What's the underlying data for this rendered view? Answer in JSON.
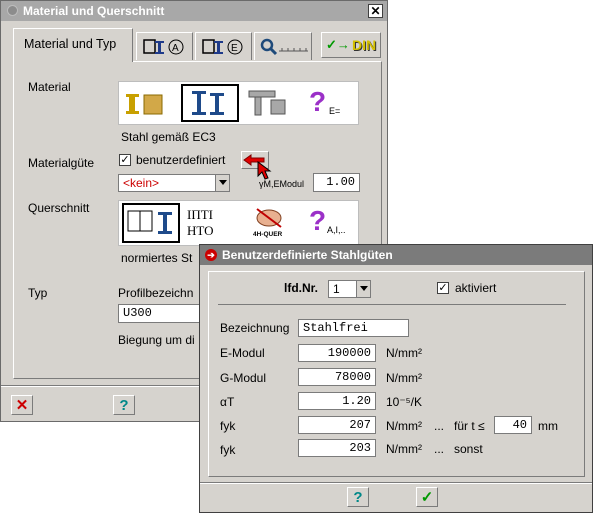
{
  "back_window": {
    "title": "Material und Querschnitt",
    "tabs": [
      {
        "label": "Material und Typ"
      }
    ],
    "din_label": "DIN",
    "material": {
      "label": "Material",
      "selected_text": "Stahl gemäß EC3",
      "other_text": "E="
    },
    "materialguete": {
      "label": "Materialgüte",
      "checkbox_label": "benutzerdefiniert",
      "dropdown_value": "<kein>",
      "gamma_label": "γM,EModul",
      "gamma_value": "1.00"
    },
    "querschnitt": {
      "label": "Querschnitt",
      "selected_text": "normiertes St",
      "quer_icon_text": "4H-QUER",
      "other_text": "A,I,.."
    },
    "typ": {
      "label": "Typ",
      "profil_label": "Profilbezeichn",
      "profil_value": "U300",
      "biegung_text": "Biegung um di"
    }
  },
  "front_window": {
    "title": "Benutzerdefinierte Stahlgüten",
    "lfd_label": "lfd.Nr.",
    "lfd_value": "1",
    "aktiviert_label": "aktiviert",
    "rows": [
      {
        "label": "Bezeichnung",
        "value": "Stahlfrei",
        "unit": ""
      },
      {
        "label": "E-Modul",
        "value": "190000",
        "unit": "N/mm²"
      },
      {
        "label": "G-Modul",
        "value": "78000",
        "unit": "N/mm²"
      },
      {
        "label": "αT",
        "value": "1.20",
        "unit": "10⁻⁵/K"
      },
      {
        "label": "fyk",
        "value": "207",
        "unit": "N/mm²"
      },
      {
        "label": "fyk",
        "value": "203",
        "unit": "N/mm²"
      }
    ],
    "fyk1_extra": {
      "dots": "...",
      "cond": "für t ≤",
      "t_value": "40",
      "t_unit": "mm"
    },
    "fyk2_extra": {
      "dots": "...",
      "cond": "sonst"
    }
  },
  "colors": {
    "accent_red": "#cc0000",
    "help_cyan": "#008888",
    "ok_green": "#009900",
    "window_bg": "#d6d3ce"
  },
  "icons": [
    "close-icon",
    "help-icon",
    "ok-check-icon",
    "magnifier-icon",
    "arrow-right-icon"
  ]
}
